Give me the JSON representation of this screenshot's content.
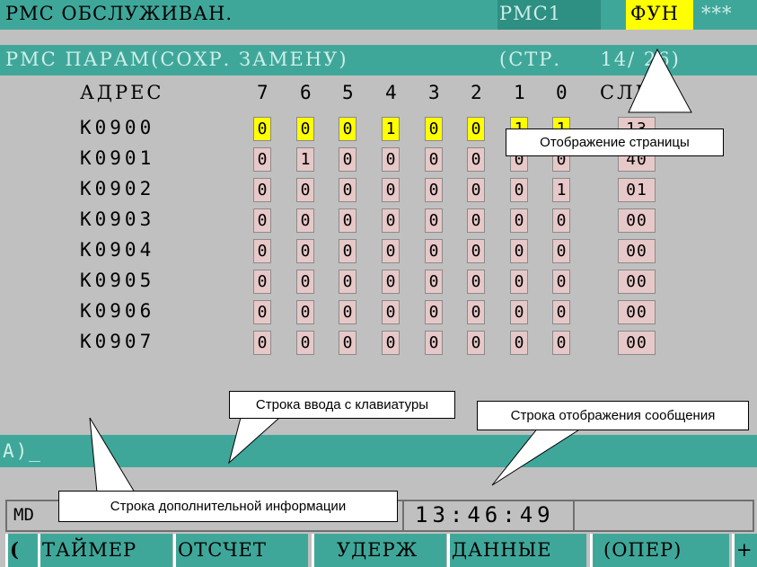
{
  "header": {
    "title": "PMC ОБСЛУЖИВАН.",
    "pmc": "PMC1",
    "fun": "ФУН",
    "stars": "***"
  },
  "subheader": {
    "left": "PMC ПАРАМ(СОХР. ЗАМЕНУ)",
    "page": "(СТР.     14/ 26)"
  },
  "table": {
    "address_header": "АДРЕС",
    "bit_headers": [
      "7",
      "6",
      "5",
      "4",
      "3",
      "2",
      "1",
      "0"
    ],
    "next_header": "СЛЕД",
    "rows": [
      {
        "addr": "K0900",
        "bits": [
          "0",
          "0",
          "0",
          "1",
          "0",
          "0",
          "1",
          "1"
        ],
        "next": "13"
      },
      {
        "addr": "K0901",
        "bits": [
          "0",
          "1",
          "0",
          "0",
          "0",
          "0",
          "0",
          "0"
        ],
        "next": "40"
      },
      {
        "addr": "K0902",
        "bits": [
          "0",
          "0",
          "0",
          "0",
          "0",
          "0",
          "0",
          "1"
        ],
        "next": "01"
      },
      {
        "addr": "K0903",
        "bits": [
          "0",
          "0",
          "0",
          "0",
          "0",
          "0",
          "0",
          "0"
        ],
        "next": "00"
      },
      {
        "addr": "K0904",
        "bits": [
          "0",
          "0",
          "0",
          "0",
          "0",
          "0",
          "0",
          "0"
        ],
        "next": "00"
      },
      {
        "addr": "K0905",
        "bits": [
          "0",
          "0",
          "0",
          "0",
          "0",
          "0",
          "0",
          "0"
        ],
        "next": "00"
      },
      {
        "addr": "K0906",
        "bits": [
          "0",
          "0",
          "0",
          "0",
          "0",
          "0",
          "0",
          "0"
        ],
        "next": "00"
      },
      {
        "addr": "K0907",
        "bits": [
          "0",
          "0",
          "0",
          "0",
          "0",
          "0",
          "0",
          "0"
        ],
        "next": "00"
      }
    ]
  },
  "input_line": {
    "prompt": "A)_"
  },
  "status": {
    "mode": "MD",
    "time": "13:46:49"
  },
  "softkeys": {
    "left_arrow": "(",
    "keys": [
      "ТАЙМЕР",
      "ОТСЧЕТ",
      "УДЕРЖ",
      "ДАННЫЕ",
      "(ОПЕР)"
    ],
    "right_plus": "+"
  },
  "callouts": {
    "page_display": "Отображение страницы",
    "keyboard_input": "Строка ввода с клавиатуры",
    "message_line": "Строка отображения сообщения",
    "extra_info": "Строка дополнительной информации"
  },
  "colors": {
    "teal": "#3fa79a",
    "yellow": "#ffff00",
    "cell_pink": "#e7c8c8",
    "background": "#c0c0c0"
  }
}
